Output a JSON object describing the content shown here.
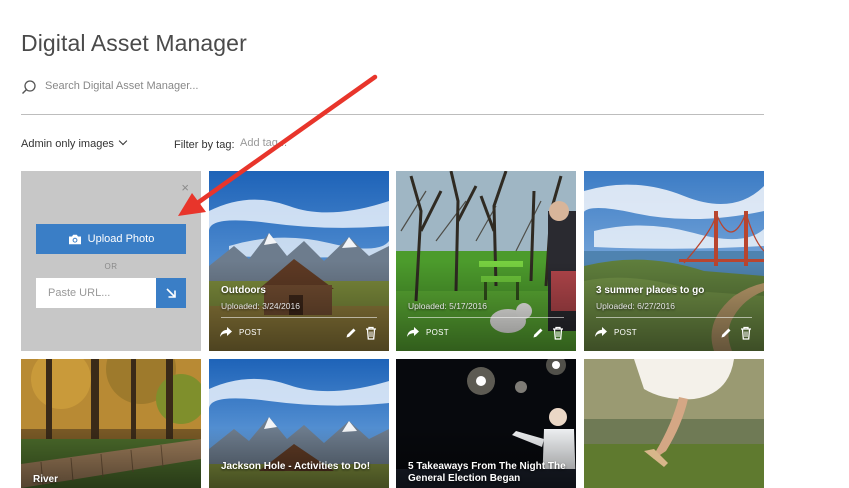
{
  "header": {
    "title": "Digital Asset Manager"
  },
  "search": {
    "placeholder": "Search Digital Asset Manager..."
  },
  "filters": {
    "visibility_label": "Admin only images",
    "tag_label": "Filter by tag:",
    "tag_placeholder": "Add tag..."
  },
  "upload": {
    "button_label": "Upload Photo",
    "or_label": "OR",
    "url_placeholder": "Paste URL...",
    "close_label": "×"
  },
  "cards": [
    {
      "title": "Outdoors",
      "uploaded": "Uploaded: 3/24/2016",
      "post_label": "POST",
      "image": "barn-mountains"
    },
    {
      "title": "",
      "uploaded": "Uploaded: 5/17/2016",
      "post_label": "POST",
      "image": "park-dog"
    },
    {
      "title": "3 summer places to go",
      "uploaded": "Uploaded: 6/27/2016",
      "post_label": "POST",
      "image": "golden-gate"
    },
    {
      "title": "River",
      "image": "forest-boardwalk"
    },
    {
      "title": "Jackson Hole - Activities to Do!",
      "image": "barn-mountains"
    },
    {
      "title": "5 Takeaways From The Night The General Election Began",
      "image": "stage-speaker"
    },
    {
      "title": "",
      "image": "dress-grass"
    }
  ],
  "icons": {
    "search": "search-icon",
    "camera": "camera-icon",
    "submit": "arrow-down-right-icon",
    "share": "share-icon",
    "edit": "pencil-icon",
    "delete": "trash-icon",
    "close": "close-icon",
    "dropdown": "chevron-down-icon"
  },
  "colors": {
    "accent": "#3a7ec6",
    "panel": "#c7c7c7",
    "annotation": "#e8352b"
  }
}
